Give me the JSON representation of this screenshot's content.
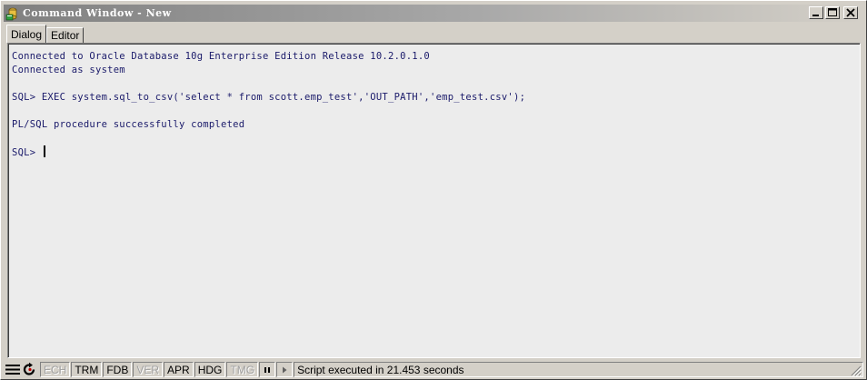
{
  "window": {
    "title": "Command Window - New",
    "controls": {
      "minimize": "minimize-icon",
      "maximize": "maximize-icon",
      "close": "close-icon"
    }
  },
  "tabs": [
    {
      "label": "Dialog",
      "active": true
    },
    {
      "label": "Editor",
      "active": false
    }
  ],
  "console": {
    "lines": [
      "Connected to Oracle Database 10g Enterprise Edition Release 10.2.0.1.0",
      "Connected as system",
      "",
      "SQL> EXEC system.sql_to_csv('select * from scott.emp_test','OUT_PATH','emp_test.csv');",
      "",
      "PL/SQL procedure successfully completed",
      ""
    ],
    "prompt": "SQL> "
  },
  "statusbar": {
    "indicators": [
      {
        "label": "ECH",
        "enabled": false
      },
      {
        "label": "TRM",
        "enabled": true
      },
      {
        "label": "FDB",
        "enabled": true
      },
      {
        "label": "VER",
        "enabled": false
      },
      {
        "label": "APR",
        "enabled": true
      },
      {
        "label": "HDG",
        "enabled": true
      },
      {
        "label": "TMG",
        "enabled": false
      }
    ],
    "message": "Script executed in 21.453 seconds"
  },
  "colors": {
    "title_gradient_start": "#808080",
    "console_text": "#1a1a6a",
    "pane_bg": "#ececec"
  }
}
